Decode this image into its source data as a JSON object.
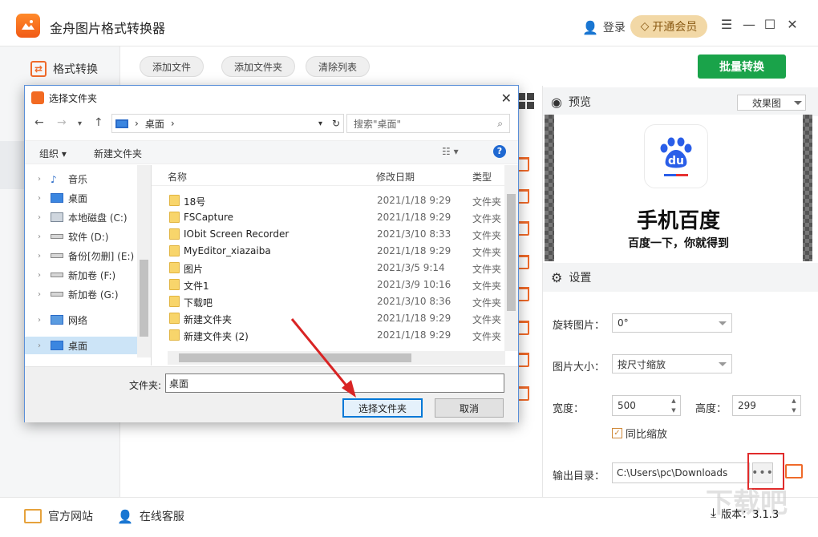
{
  "app": {
    "title": "金舟图片格式转换器",
    "login_label": "登录",
    "vip_label": "开通会员"
  },
  "sidebar": {
    "items": [
      {
        "label": "格式转换"
      }
    ]
  },
  "toolbar": {
    "add_file": "添加文件",
    "add_folder": "添加文件夹",
    "clear_list": "清除列表",
    "batch_convert": "批量转换"
  },
  "preview": {
    "title": "预览",
    "mode": "效果图",
    "image_title": "手机百度",
    "image_slogan": "百度一下，你就得到",
    "logo_text": "du"
  },
  "settings": {
    "title": "设置",
    "rotate_label": "旋转图片：",
    "rotate_value": "0°",
    "size_label": "图片大小：",
    "size_value": "按尺寸缩放",
    "width_label": "宽度：",
    "width_value": "500",
    "height_label": "高度：",
    "height_value": "299",
    "proportional_label": "同比缩放",
    "output_label": "输出目录：",
    "output_value": "C:\\Users\\pc\\Downloads",
    "more_label": "•••"
  },
  "footer": {
    "website": "官方网站",
    "support": "在线客服",
    "version": "版本：3.1.3",
    "watermark": "下载吧"
  },
  "dialog": {
    "title": "选择文件夹",
    "breadcrumb": "桌面",
    "search_placeholder": "搜索\"桌面\"",
    "organize": "组织",
    "new_folder": "新建文件夹",
    "tree": [
      {
        "label": "音乐"
      },
      {
        "label": "桌面"
      },
      {
        "label": "本地磁盘 (C:)"
      },
      {
        "label": "软件 (D:)"
      },
      {
        "label": "备份[勿删] (E:)"
      },
      {
        "label": "新加卷 (F:)"
      },
      {
        "label": "新加卷 (G:)"
      },
      {
        "label": "网络"
      },
      {
        "label": "桌面"
      }
    ],
    "columns": {
      "name": "名称",
      "date": "修改日期",
      "type": "类型"
    },
    "files": [
      {
        "name": "18号",
        "date": "2021/1/18 9:29",
        "type": "文件夹"
      },
      {
        "name": "FSCapture",
        "date": "2021/1/18 9:29",
        "type": "文件夹"
      },
      {
        "name": "IObit Screen Recorder",
        "date": "2021/3/10 8:33",
        "type": "文件夹"
      },
      {
        "name": "MyEditor_xiazaiba",
        "date": "2021/1/18 9:29",
        "type": "文件夹"
      },
      {
        "name": "图片",
        "date": "2021/3/5 9:14",
        "type": "文件夹"
      },
      {
        "name": "文件1",
        "date": "2021/3/9 10:16",
        "type": "文件夹"
      },
      {
        "name": "下载吧",
        "date": "2021/3/10 8:36",
        "type": "文件夹"
      },
      {
        "name": "新建文件夹",
        "date": "2021/1/18 9:29",
        "type": "文件夹"
      },
      {
        "name": "新建文件夹 (2)",
        "date": "2021/1/18 9:29",
        "type": "文件夹"
      }
    ],
    "folder_label": "文件夹:",
    "folder_value": "桌面",
    "select_button": "选择文件夹",
    "cancel_button": "取消"
  }
}
